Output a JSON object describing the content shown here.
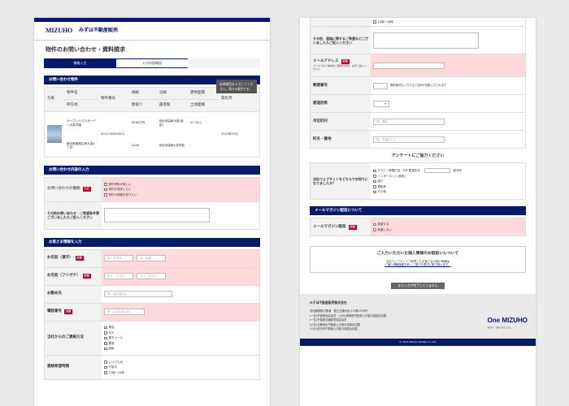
{
  "header": {
    "logo_text": "MIZUHO",
    "logo_sub": "みずほ不動産販売",
    "brand": "みずほ不動産販売"
  },
  "page_title": "物件のお問い合わせ・資料請求",
  "steps": [
    "情報入力",
    "入力内容確認",
    ""
  ],
  "tooltip": "必須項目を入力してください。残り8項目です。",
  "property": {
    "section_title": "お問い合わせ物件",
    "headers": {
      "photo": "写真",
      "name": "物件名",
      "location": "所在地",
      "number": "物件番号",
      "price": "価格",
      "layout": "間取り",
      "line": "沿線",
      "station": "最寄駅",
      "area": "建物面積",
      "land": "土地面積",
      "year": "築年月"
    },
    "values": {
      "name": "オープンハウスガーデン大泉学園",
      "location": "東京都練馬区東大泉4丁目",
      "number": "0012-90944203",
      "price": "4480万円",
      "layout": "2LDK",
      "line": "西武池袋線(池袋-飯能)",
      "station": "西武池袋線大泉学園",
      "area": "55.53㎡",
      "land": "-",
      "year": "2015年09月"
    }
  },
  "inquiry": {
    "section_title": "お問い合わせ内容の入力",
    "type_label": "お問い合わせの種類",
    "options": [
      "物件資料が欲しい",
      "物件を見学したい",
      "物件の詳細を知りたい"
    ],
    "free_label": "その他お問い合わせ・ご希望条件等ございましたらご記入ください"
  },
  "customer": {
    "section_title": "お客さま情報を入力",
    "name_label": "お名前（漢字）",
    "name_ph1": "姓：みずほ",
    "name_ph2": "名：太郎",
    "kana_label": "お名前（フリガナ）",
    "kana_ph1": "セイ：ミズホ",
    "kana_ph2": "メイ：タロウ",
    "work_label": "お勤め先",
    "work_ph": "例：会社名など",
    "phone_label": "電話番号",
    "phone_ph": "例：0120-00-00",
    "contact_label": "当社からのご連絡方法",
    "contact_options": [
      "電話",
      "FAX",
      "電子メール",
      "郵便",
      "面談"
    ],
    "time_label": "連絡希望時間",
    "time_options": [
      "いつでも可",
      "午前中",
      "12時〜15時"
    ]
  },
  "right": {
    "top_option": "15時〜18時",
    "other_label": "その他、連絡に関するご希望などございましたらご記入ください",
    "email_label": "メールアドレス",
    "email_note": "メールでのご案内をご希望の方は、必ずご記入ください",
    "zip_label": "郵便番号",
    "zip_note": "郵便番号を入力すると住所が自動入力されます",
    "pref_label": "都道府県",
    "city_label": "市区町村",
    "city_ph": "例：港区",
    "street_label": "町名・番地",
    "street_ph": "例：芝浦1-1-1",
    "survey_title": "アンケートにご協力ください",
    "survey_label": "当社ウェブサイトをどちらでお知りになりましたか？",
    "survey_options": [
      "チラシ・新聞広告・DM 配達先名",
      "インターネット(検索)",
      "紹介",
      "看板等",
      "その他"
    ],
    "survey_input_label": "配布先",
    "mag_section": "メールマガジン配信について",
    "mag_label": "メールマガジン配信",
    "mag_options": [
      "希望する",
      "希望しない"
    ],
    "privacy_title": "ご入力いただいた個人情報のお取扱いについて",
    "privacy_text": "当社ウェブサイトで取得したお客さまの個人情報は",
    "privacy_text2": "「個人情報保護方針」に基づき適切に取り扱います。",
    "submit": "まだ入力が完了していません",
    "footer_company": "みずほ不動産販売株式会社",
    "footer_lines": [
      "宅地建物取引業者　国土交通大臣(13)第2529号",
      "(一社)不動産協会会員　(公社)首都圏不動産公正取引協議会加盟",
      "(一社)不動産流通経営協会会員",
      "(公社)近畿地区不動産公正取引協議会加盟",
      "(公社)西日本不動産公正取引協議会加盟"
    ],
    "footer_brand": "One MIZUHO",
    "footer_brand_sub": "未来へ。お客さまとともに",
    "copyright": "© 2015 Mizuho Realty Co.,Ltd."
  }
}
